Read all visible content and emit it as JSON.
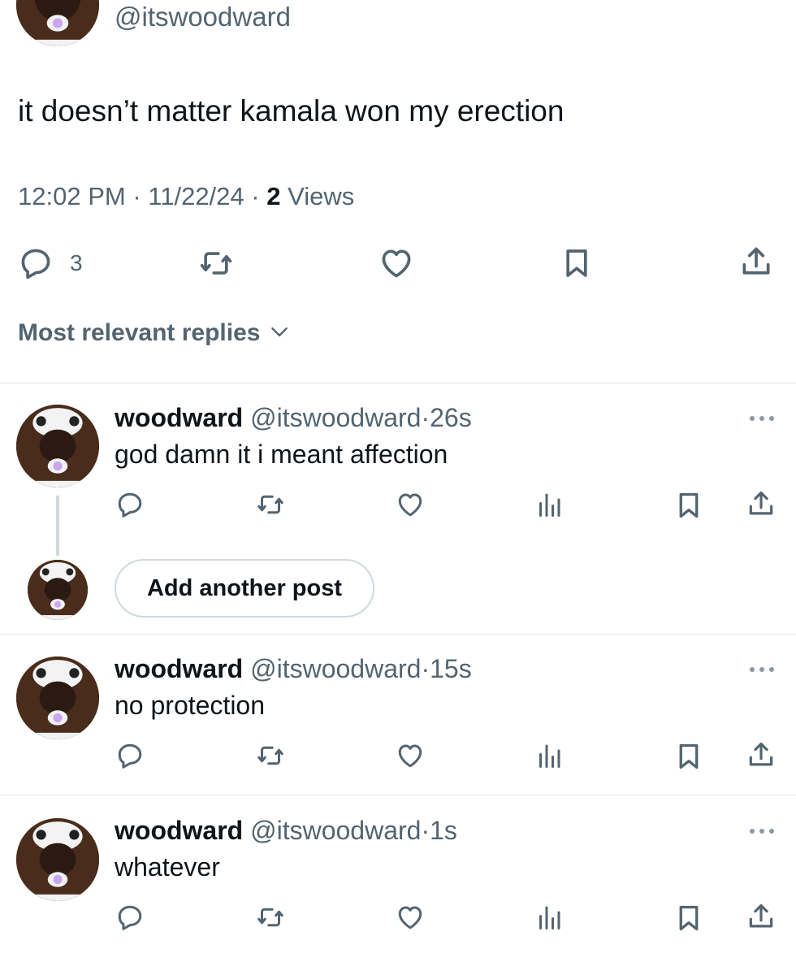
{
  "main_post": {
    "handle": "@itswoodward",
    "text": "it doesn’t matter kamala won my erection",
    "time": "12:02 PM",
    "separator": "·",
    "date": "11/22/24",
    "views_count": "2",
    "views_label": "Views",
    "reply_count": "3",
    "icons": [
      "reply-icon",
      "retweet-icon",
      "like-icon",
      "bookmark-icon",
      "share-icon"
    ]
  },
  "replies_sort": {
    "label": "Most relevant replies",
    "icon": "chevron-down-icon"
  },
  "thread": [
    {
      "name": "woodward",
      "handle": "@itswoodward",
      "dot": "·",
      "time": "26s",
      "text": "god damn it i meant affection"
    },
    {
      "name": "woodward",
      "handle": "@itswoodward",
      "dot": "·",
      "time": "15s",
      "text": "no protection"
    },
    {
      "name": "woodward",
      "handle": "@itswoodward",
      "dot": "·",
      "time": "1s",
      "text": "whatever"
    }
  ],
  "composer": {
    "add_label": "Add another post"
  },
  "action_icons": [
    "reply-icon",
    "retweet-icon",
    "like-icon",
    "views-icon",
    "bookmark-icon",
    "share-icon"
  ],
  "colors": {
    "text": "#0f1419",
    "muted": "#536471",
    "divider": "#e6e9ec",
    "thread_line": "#cfd9de"
  }
}
